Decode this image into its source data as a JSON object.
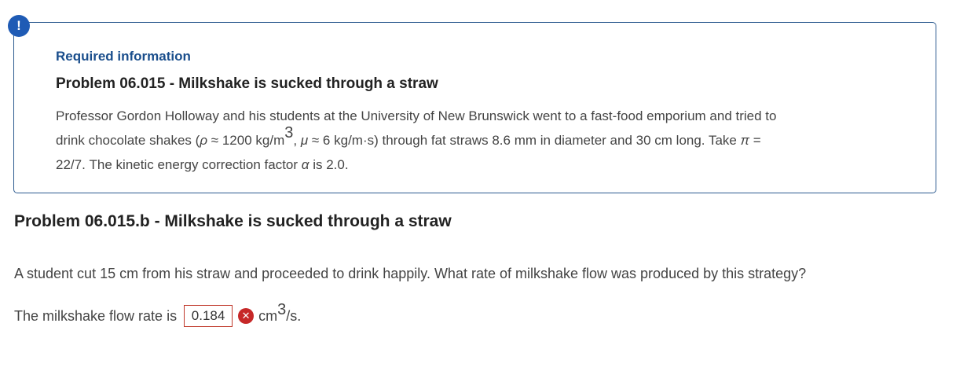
{
  "alert_icon_glyph": "!",
  "info": {
    "heading": "Required information",
    "title": "Problem 06.015 - Milkshake is sucked through a straw",
    "body_line1": "Professor Gordon Holloway and his students at the University of New Brunswick went to a fast-food emporium and tried to",
    "body_line2_a": "drink chocolate shakes (",
    "rho_symbol": "ρ",
    "body_line2_b": " ≈ 1200 kg/m",
    "exp3": "3",
    "body_line2_c": ", ",
    "mu_symbol": "μ",
    "body_line2_d": " ≈ 6 kg/m·s) through fat straws 8.6 mm in diameter and 30 cm long. Take ",
    "pi_symbol": "π",
    "body_line2_e": " =",
    "body_line3_a": "22/7. The kinetic energy correction factor ",
    "alpha_symbol": "α",
    "body_line3_b": " is 2.0."
  },
  "problem": {
    "title": "Problem 06.015.b - Milkshake is sucked through a straw",
    "question": "A student cut 15 cm from his straw and proceeded to drink happily. What rate of milkshake flow was produced by this strategy?",
    "answer_label": "The milkshake flow rate is",
    "answer_value": "0.184",
    "answer_status": "incorrect",
    "unit_base": "cm",
    "unit_exp": "3",
    "unit_tail": "/s."
  },
  "colors": {
    "accent_blue": "#1f5bb5",
    "heading_blue": "#1a4e8c",
    "panel_border": "#2c5a8f",
    "error_red": "#c62828"
  },
  "icons": [
    "alert-icon",
    "incorrect-x-icon"
  ]
}
